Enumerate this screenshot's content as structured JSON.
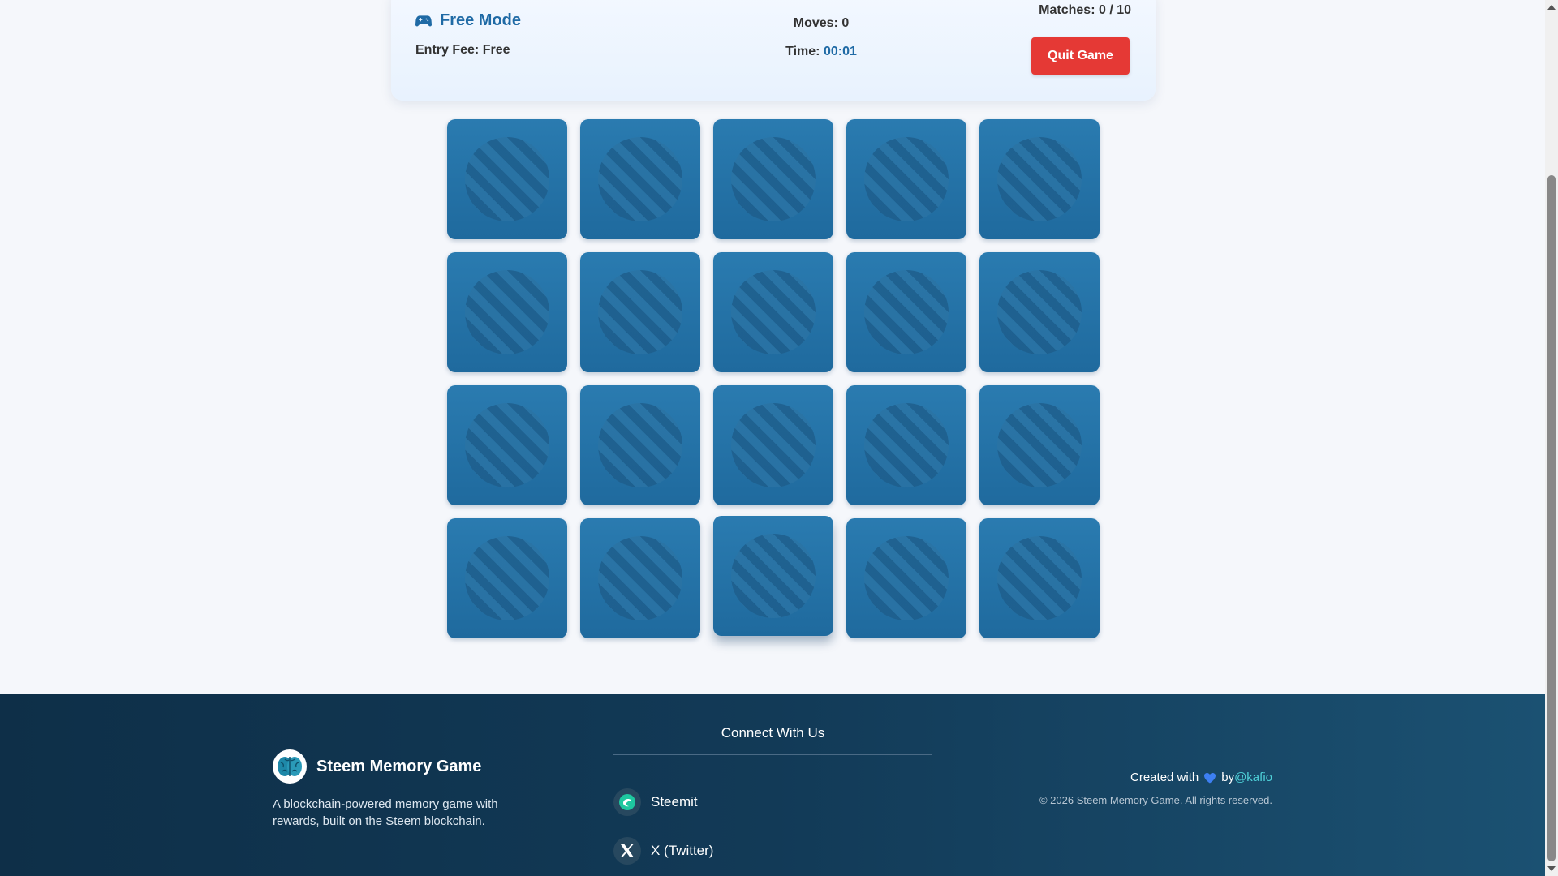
{
  "status": {
    "mode_label": "Free Mode",
    "entry_fee": "Entry Fee: Free",
    "moves_label": "Moves: 0",
    "time_prefix": "Time: ",
    "time_value": "00:01",
    "matches_prefix": "Matches: ",
    "matches_value": "0 / 10",
    "quit_label": "Quit Game",
    "mode_icon": "gamepad-icon",
    "colors": {
      "accent": "#1f6aa5",
      "quit": "#e53935"
    }
  },
  "board": {
    "rows": 4,
    "columns": 5,
    "card_state": "face-down",
    "card_color": "#2470a6"
  },
  "footer": {
    "brand_name": "Steem Memory Game",
    "brand_icon": "brain-icon",
    "brand_desc": "A blockchain-powered memory game with rewards, built on the Steem blockchain.",
    "connect_title": "Connect With Us",
    "socials": [
      {
        "label": "Steemit",
        "icon": "steemit-icon"
      },
      {
        "label": "X (Twitter)",
        "icon": "x-twitter-icon"
      }
    ],
    "created_prefix": "Created with",
    "heart_icon": "heart-icon",
    "created_by": "by",
    "author": "@kafio",
    "copyright": "© 2026 Steem Memory Game. All rights reserved.",
    "colors": {
      "author_link": "#4fd1d9"
    }
  }
}
